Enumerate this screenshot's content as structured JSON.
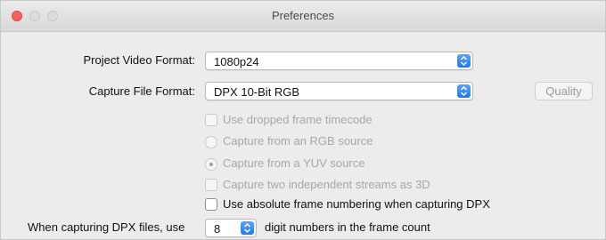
{
  "window": {
    "title": "Preferences"
  },
  "project_format": {
    "label": "Project Video Format:",
    "value": "1080p24"
  },
  "capture_format": {
    "label": "Capture File Format:",
    "value": "DPX 10-Bit RGB",
    "quality_button": "Quality"
  },
  "options": {
    "dropped_frame": "Use dropped frame timecode",
    "rgb_source": "Capture from an RGB source",
    "yuv_source": "Capture from a YUV source",
    "two_streams": "Capture two independent streams as 3D",
    "absolute_numbering": "Use absolute frame numbering when capturing DPX"
  },
  "dpx_digits": {
    "prefix": "When capturing DPX files, use",
    "value": "8",
    "suffix": "digit numbers in the frame count"
  },
  "colors": {
    "accent": "#1c7af5",
    "close": "#fc605c"
  },
  "icons": [
    "close-button",
    "minimize-button",
    "maximize-button",
    "select-stepper-icon",
    "radio-selected-dot"
  ]
}
